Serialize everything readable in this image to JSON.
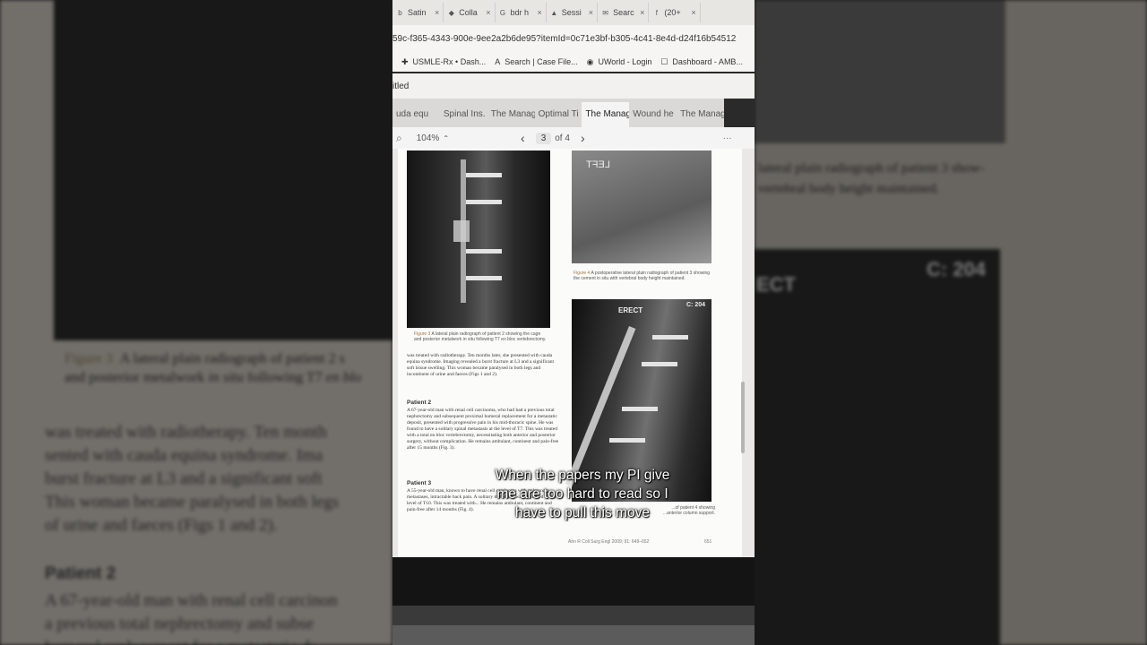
{
  "browser": {
    "tabs": [
      {
        "icon": "b",
        "title": "Satin"
      },
      {
        "icon": "◆",
        "title": "Colla"
      },
      {
        "icon": "G",
        "title": "bdr h"
      },
      {
        "icon": "▲",
        "title": "Sessi"
      },
      {
        "icon": "✉",
        "title": "Searc"
      },
      {
        "icon": "f",
        "title": "(20+"
      }
    ],
    "tab_close": "×",
    "url": "59c-f365-4343-900e-9ee2a2b6de95?itemId=0c71e3bf-b305-4c41-8e4d-d24f16b54512",
    "bookmarks": [
      {
        "icon": "✚",
        "label": "USMLE-Rx • Dash..."
      },
      {
        "icon": "A",
        "label": "Search | Case File..."
      },
      {
        "icon": "◉",
        "label": "UWorld - Login"
      },
      {
        "icon": "☐",
        "label": "Dashboard - AMB..."
      }
    ]
  },
  "document": {
    "title": "itled",
    "pdf_tabs": [
      "uda equ",
      "Spinal Ins.",
      "The Manag",
      "Optimal Ti",
      "The Manag",
      "Wound he",
      "The Manag"
    ],
    "active_tab": 4,
    "toolbar": {
      "search_icon": "⌕",
      "zoom": "104%",
      "zoom_caret": "⌃",
      "prev": "‹",
      "page": "3",
      "of": "of 4",
      "next": "›",
      "more": "···"
    }
  },
  "pdf_page": {
    "fig3_caption_label": "Figure 3",
    "fig3_caption": "A lateral plain radiograph of patient 2 showing the cage and posterior metalwork in situ following T7 en bloc vertebrectomy.",
    "fig4_caption_label": "Figure 4",
    "fig4_caption": "A postoperative lateral plain radiograph of patient 3 showing the cement in situ with vertebral body height maintained.",
    "fig4_marker": "LEFT",
    "fig5_labels": {
      "left": "ERECT",
      "right": "C: 204"
    },
    "fig5_caption": "...of patient 4 showing ...anterior column support.",
    "para1": "was treated with radiotherapy. Ten months later, she presented with cauda equina syndrome. Imaging revealed a burst fracture at L3 and a significant soft tissue swelling. This woman became paralysed in both legs and incontinent of urine and faeces (Figs 1 and 2).",
    "patient2_head": "Patient 2",
    "patient2_text": "A 67-year-old man with renal cell carcinoma, who had had a previous total nephrectomy and subsequent proximal humeral replacement for a metastatic deposit, presented with progressive pain in his mid-thoracic spine. He was found to have a solitary spinal metastasis at the level of T7. This was treated with a total en bloc vertebrectomy, necessitating both anterior and posterior surgery, without complication. He remains ambulant, continent and pain-free after 15 months (Fig. 3).",
    "patient3_head": "Patient 3",
    "patient3_text": "A 55-year-old man, known to have renal cell carcinoma with pulmonary metastases, intractable back pain. A solitary metastasis was identified at the level of T10. This was treated with... He remains ambulant, continent and pain-free after 14 months (Fig. 4).",
    "footer_journal": "Ann R Coll Surg Engl 2009; 91: 649–652",
    "footer_page": "651"
  },
  "subtitle": {
    "line1": "When the papers my PI give",
    "line2": "me are too hard to read so I",
    "line3": "have to pull this move"
  },
  "background": {
    "left_caption_label": "Figure 3",
    "left_caption_1": "A lateral plain radiograph of patient 2 s",
    "left_caption_2a": "and posterior metalwork ",
    "left_caption_2b": "in situ",
    "left_caption_2c": " following T7 ",
    "left_caption_2d": "en blo",
    "left_text": [
      "was treated with radiotherapy. Ten month",
      "sented with cauda equina syndrome. Ima",
      "burst fracture at L3 and a significant soft",
      "This woman became paralysed in both legs",
      "of urine and faeces (Figs 1 and 2)."
    ],
    "left_head": "Patient 2",
    "left_text2": [
      "A 67-year-old man with renal cell carcinon",
      "a previous total nephrectomy and subse",
      "humeral replacement for a metastatic de"
    ],
    "right_caption_1": "lateral plain radiograph of patient 3 show-",
    "right_caption_2": "vertebral body height maintained.",
    "right_label_left": "ECT",
    "right_label_right": "C: 204"
  }
}
